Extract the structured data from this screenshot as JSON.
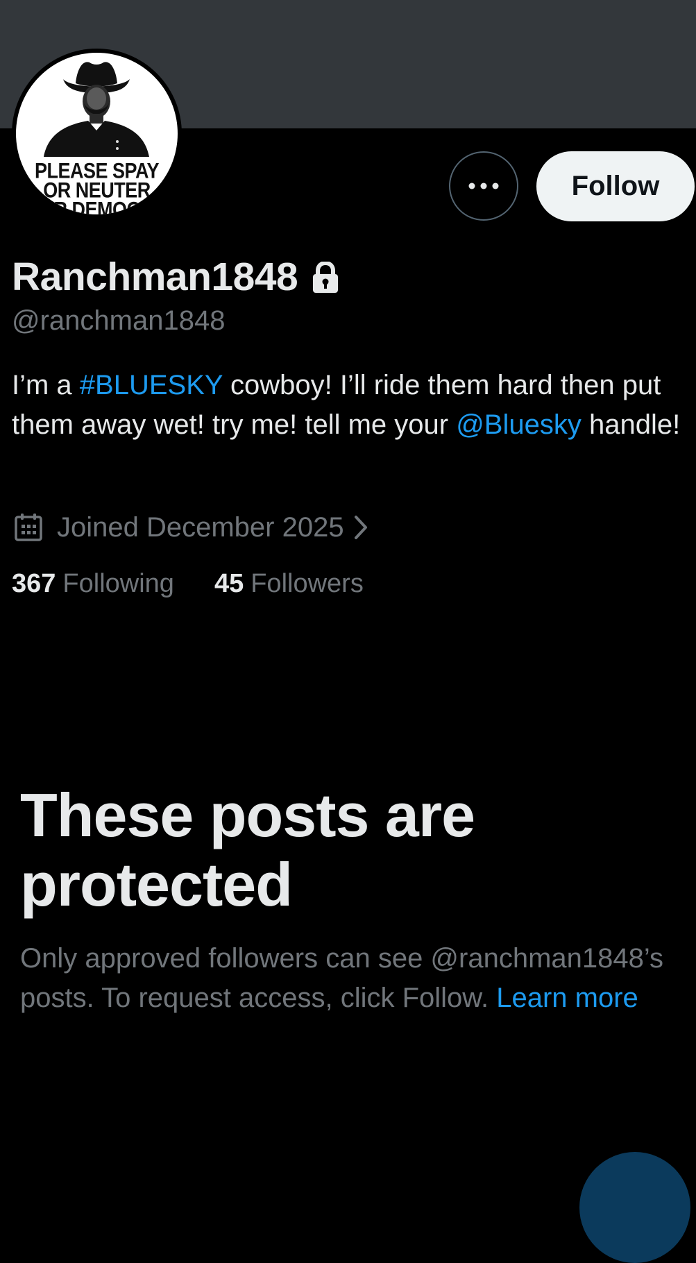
{
  "profile": {
    "display_name": "Ranchman1848",
    "handle": "@ranchman1848",
    "avatar_text": [
      "PLEASE SPAY",
      "OR NEUTER",
      "UR DEMOCR"
    ],
    "bio": {
      "part1": "I’m a ",
      "hashtag": "#BLUESKY",
      "part2": " cowboy!  I’ll ride them hard then put them away wet!  try me!  tell me your ",
      "mention": "@Bluesky",
      "part3": " handle!"
    },
    "joined": "Joined December 2025",
    "following_count": "367",
    "following_label": "Following",
    "followers_count": "45",
    "followers_label": "Followers"
  },
  "actions": {
    "follow_label": "Follow"
  },
  "protected": {
    "title": "These posts are protected",
    "body": "Only approved followers can see @ranchman1848’s posts. To request access, click Follow. ",
    "learn_more": "Learn more"
  },
  "colors": {
    "background": "#000000",
    "banner": "#33373b",
    "text_primary": "#e7e9ea",
    "text_secondary": "#71767b",
    "link": "#1d9bf0",
    "follow_bg": "#eff3f4"
  },
  "icons": {
    "more": "more-horizontal-icon",
    "lock": "lock-icon",
    "calendar": "calendar-icon",
    "chevron": "chevron-right-icon"
  }
}
